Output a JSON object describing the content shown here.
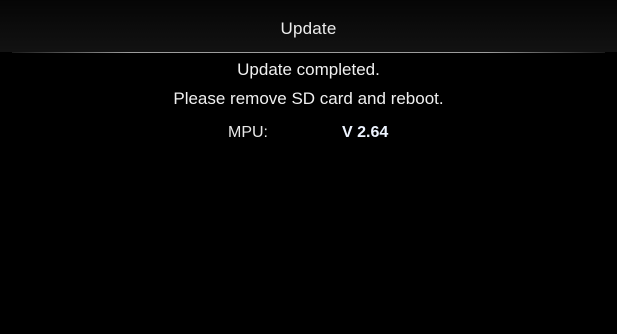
{
  "header": {
    "title": "Update"
  },
  "message": {
    "line1": "Update completed.",
    "line2": "Please remove SD card and reboot."
  },
  "version": {
    "label": "MPU:",
    "value": "V 2.64"
  },
  "colors": {
    "background": "#000000",
    "text": "#e6e6e6"
  }
}
